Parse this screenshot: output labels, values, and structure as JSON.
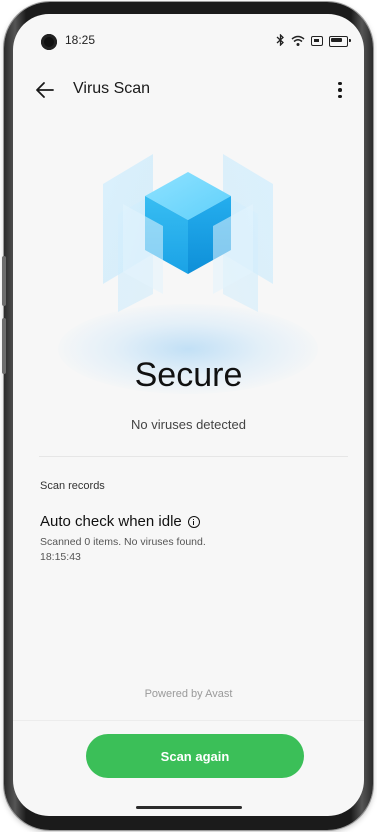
{
  "status_bar": {
    "time": "18:25",
    "icons": [
      "bluetooth-icon",
      "wifi-icon",
      "sim-icon",
      "battery-icon"
    ]
  },
  "app_bar": {
    "title": "Virus Scan",
    "back_icon": "arrow-left-icon",
    "menu_icon": "more-vertical-icon"
  },
  "result": {
    "status": "Secure",
    "detail": "No viruses detected"
  },
  "records": {
    "section_label": "Scan records",
    "items": [
      {
        "title": "Auto check when idle",
        "info_icon": "info-icon",
        "description": "Scanned 0 items. No viruses found.",
        "time": "18:15:43"
      }
    ]
  },
  "footer": {
    "powered_by": "Powered by Avast",
    "scan_button_label": "Scan again"
  },
  "colors": {
    "accent_green": "#3bbf58",
    "cube_blue": "#2ab8f0",
    "background": "#f7f7f7"
  }
}
